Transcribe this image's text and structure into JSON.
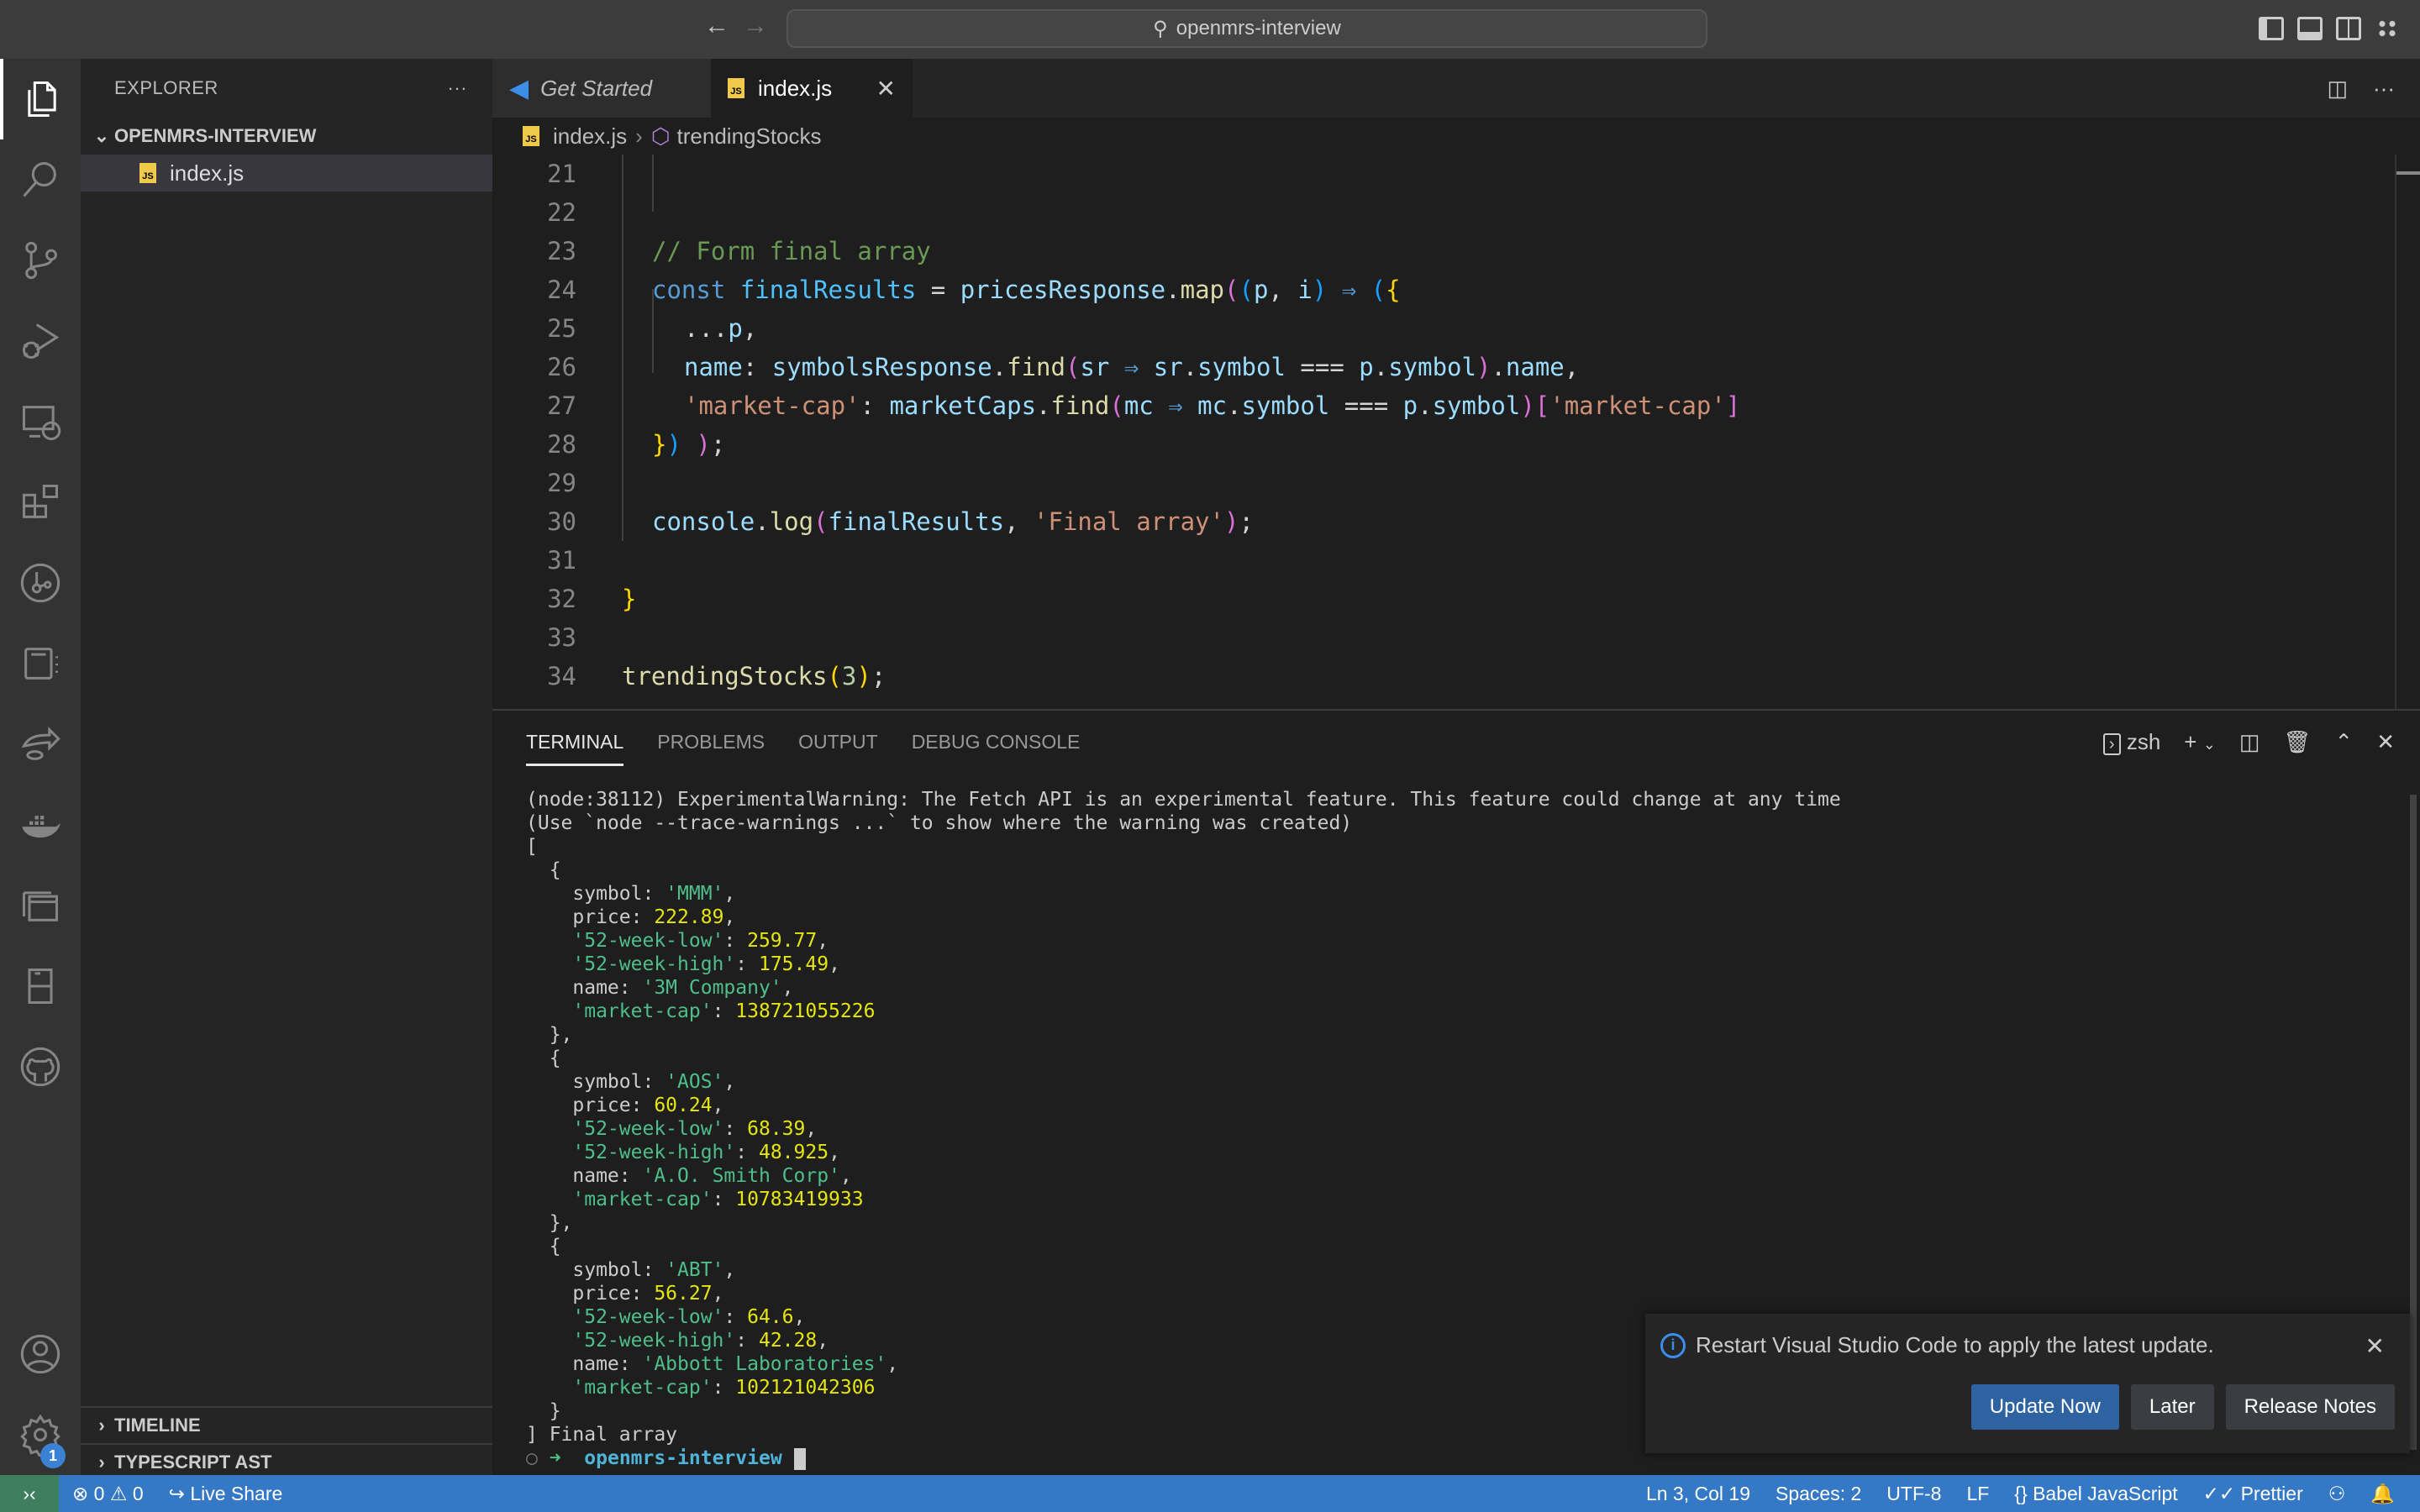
{
  "titlebar": {
    "search_text": "openmrs-interview",
    "back": "←",
    "forward": "→"
  },
  "activity_bar": {
    "items": [
      "explorer",
      "search",
      "source-control",
      "run-debug",
      "remote-explorer",
      "extensions",
      "git-graph",
      "notebook",
      "live-share",
      "docker",
      "containers",
      "database",
      "github"
    ],
    "bottom": [
      "accounts",
      "manage"
    ],
    "manage_badge": "1"
  },
  "sidebar": {
    "title": "EXPLORER",
    "more": "···",
    "folder": "OPENMRS-INTERVIEW",
    "files": [
      {
        "name": "index.js",
        "icon": "js"
      }
    ],
    "sections": [
      "TIMELINE",
      "TYPESCRIPT AST"
    ]
  },
  "tabs": [
    {
      "label": "Get Started",
      "active": false
    },
    {
      "label": "index.js",
      "active": true,
      "close": "✕"
    }
  ],
  "breadcrumb": {
    "file": "index.js",
    "symbol": "trendingStocks"
  },
  "editor": {
    "lines": [
      {
        "n": "21"
      },
      {
        "n": "22"
      },
      {
        "n": "23",
        "comment": "// Form final array"
      },
      {
        "n": "24"
      },
      {
        "n": "25"
      },
      {
        "n": "26"
      },
      {
        "n": "27"
      },
      {
        "n": "28"
      },
      {
        "n": "29"
      },
      {
        "n": "30"
      },
      {
        "n": "31"
      },
      {
        "n": "32"
      },
      {
        "n": "33"
      },
      {
        "n": "34"
      }
    ],
    "tokens": {
      "const": "const",
      "finalResults": "finalResults",
      "pricesResponse": "pricesResponse",
      "map": "map",
      "p": "p",
      "i": "i",
      "arrow": "⇒",
      "spread": "...",
      "name": "name",
      "symbolsResponse": "symbolsResponse",
      "find": "find",
      "sr": "sr",
      "symbol": "symbol",
      "eq": "===",
      "marketcap_str": "'market-cap'",
      "marketCaps": "marketCaps",
      "mc": "mc",
      "console": "console",
      "log": "log",
      "final_str": "'Final array'",
      "trendingStocks": "trendingStocks",
      "three": "3"
    }
  },
  "panel": {
    "tabs": [
      "TERMINAL",
      "PROBLEMS",
      "OUTPUT",
      "DEBUG CONSOLE"
    ],
    "active_tab": "TERMINAL",
    "shell": "zsh",
    "terminal": {
      "warning1": "(node:38112) ExperimentalWarning: The Fetch API is an experimental feature. This feature could change at any time",
      "warning2": "(Use `node --trace-warnings ...` to show where the warning was created)",
      "results": [
        {
          "symbol": "'MMM'",
          "price": "222.89",
          "low": "259.77",
          "high": "175.49",
          "name": "'3M Company'",
          "cap": "138721055226"
        },
        {
          "symbol": "'AOS'",
          "price": "60.24",
          "low": "68.39",
          "high": "48.925",
          "name": "'A.O. Smith Corp'",
          "cap": "10783419933"
        },
        {
          "symbol": "'ABT'",
          "price": "56.27",
          "low": "64.6",
          "high": "42.28",
          "name": "'Abbott Laboratories'",
          "cap": "102121042306"
        }
      ],
      "final_label": "Final array",
      "prompt_dir": "openmrs-interview"
    }
  },
  "notification": {
    "message": "Restart Visual Studio Code to apply the latest update.",
    "buttons": [
      "Update Now",
      "Later",
      "Release Notes"
    ]
  },
  "statusbar": {
    "errors": "0",
    "warnings": "0",
    "live_share": "Live Share",
    "position": "Ln 3, Col 19",
    "spaces": "Spaces: 2",
    "encoding": "UTF-8",
    "eol": "LF",
    "language": "Babel JavaScript",
    "formatter": "Prettier"
  }
}
